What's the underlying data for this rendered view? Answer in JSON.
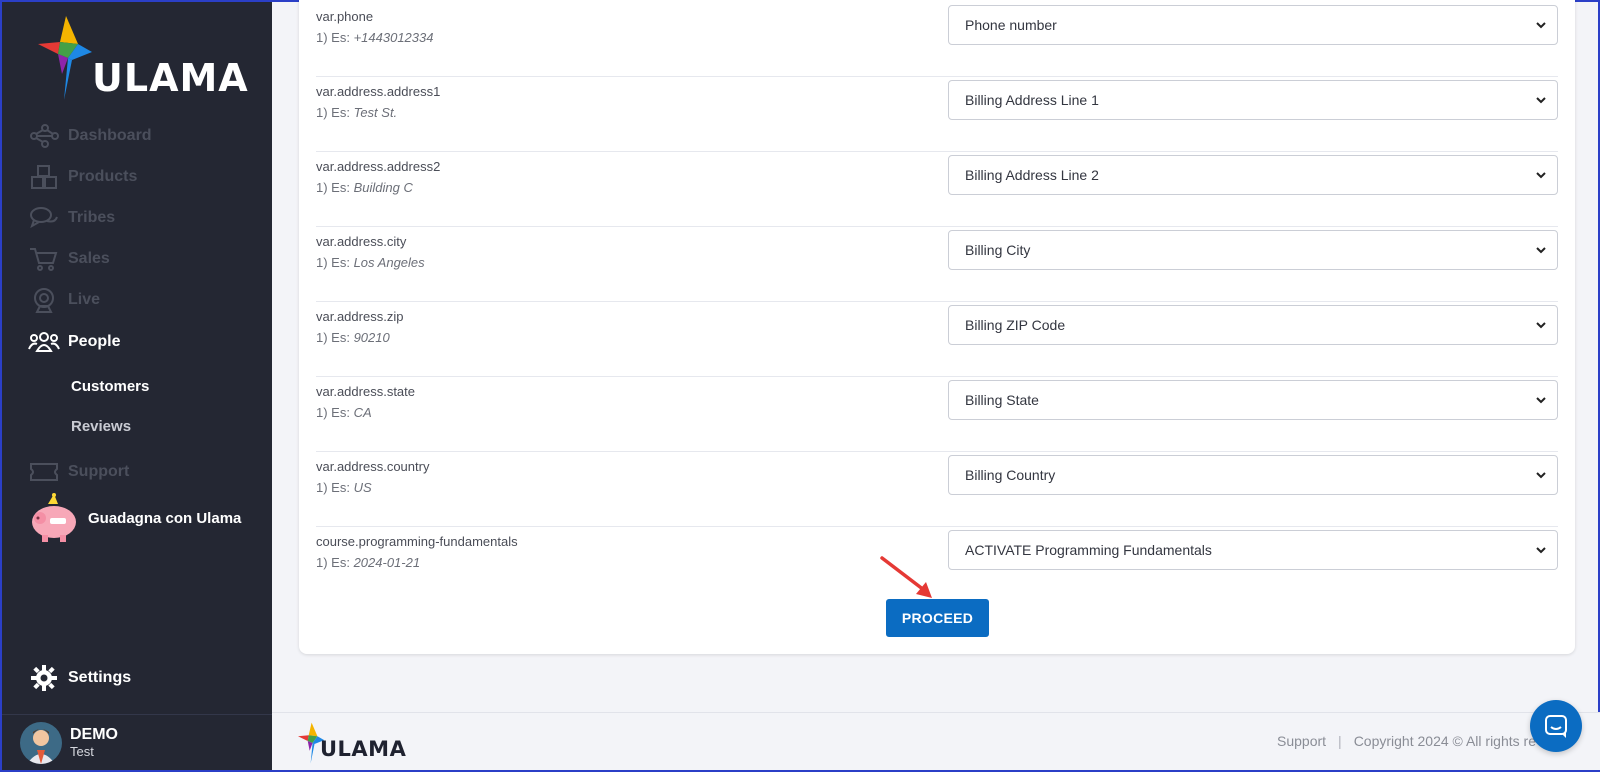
{
  "brand": {
    "name": "ULAMA"
  },
  "sidebar": {
    "items": [
      {
        "label": "Dashboard",
        "icon": "network-icon"
      },
      {
        "label": "Products",
        "icon": "boxes-icon"
      },
      {
        "label": "Tribes",
        "icon": "chat-bubbles-icon"
      },
      {
        "label": "Sales",
        "icon": "cart-icon"
      },
      {
        "label": "Live",
        "icon": "webcam-icon"
      },
      {
        "label": "People",
        "icon": "people-icon"
      },
      {
        "label": "Support",
        "icon": "ticket-icon"
      }
    ],
    "sub_items": [
      {
        "label": "Customers"
      },
      {
        "label": "Reviews"
      }
    ],
    "promo_label": "Guadagna con Ulama",
    "settings_label": "Settings",
    "user": {
      "name": "DEMO",
      "sub": "Test"
    }
  },
  "mapping": {
    "rows": [
      {
        "var": "var.phone",
        "prefix": "1) Es: ",
        "example": "+1443012334",
        "selected": "Phone number"
      },
      {
        "var": "var.address.address1",
        "prefix": "1) Es: ",
        "example": "Test St.",
        "selected": "Billing Address Line 1"
      },
      {
        "var": "var.address.address2",
        "prefix": "1) Es: ",
        "example": "Building C",
        "selected": "Billing Address Line 2"
      },
      {
        "var": "var.address.city",
        "prefix": "1) Es: ",
        "example": "Los Angeles",
        "selected": "Billing City"
      },
      {
        "var": "var.address.zip",
        "prefix": "1) Es: ",
        "example": "90210",
        "selected": "Billing ZIP Code"
      },
      {
        "var": "var.address.state",
        "prefix": "1) Es: ",
        "example": "CA",
        "selected": "Billing State"
      },
      {
        "var": "var.address.country",
        "prefix": "1) Es: ",
        "example": "US",
        "selected": "Billing Country"
      },
      {
        "var": "course.programming-fundamentals",
        "prefix": "1) Es: ",
        "example": "2024-01-21",
        "selected": "ACTIVATE Programming Fundamentals"
      }
    ],
    "proceed_label": "PROCEED"
  },
  "footer": {
    "support_label": "Support",
    "separator": "|",
    "copyright": "Copyright 2024 © All rights re"
  },
  "colors": {
    "sidebar_bg": "#242733",
    "accent": "#0b6cc2",
    "annotation_arrow": "#e53935"
  }
}
